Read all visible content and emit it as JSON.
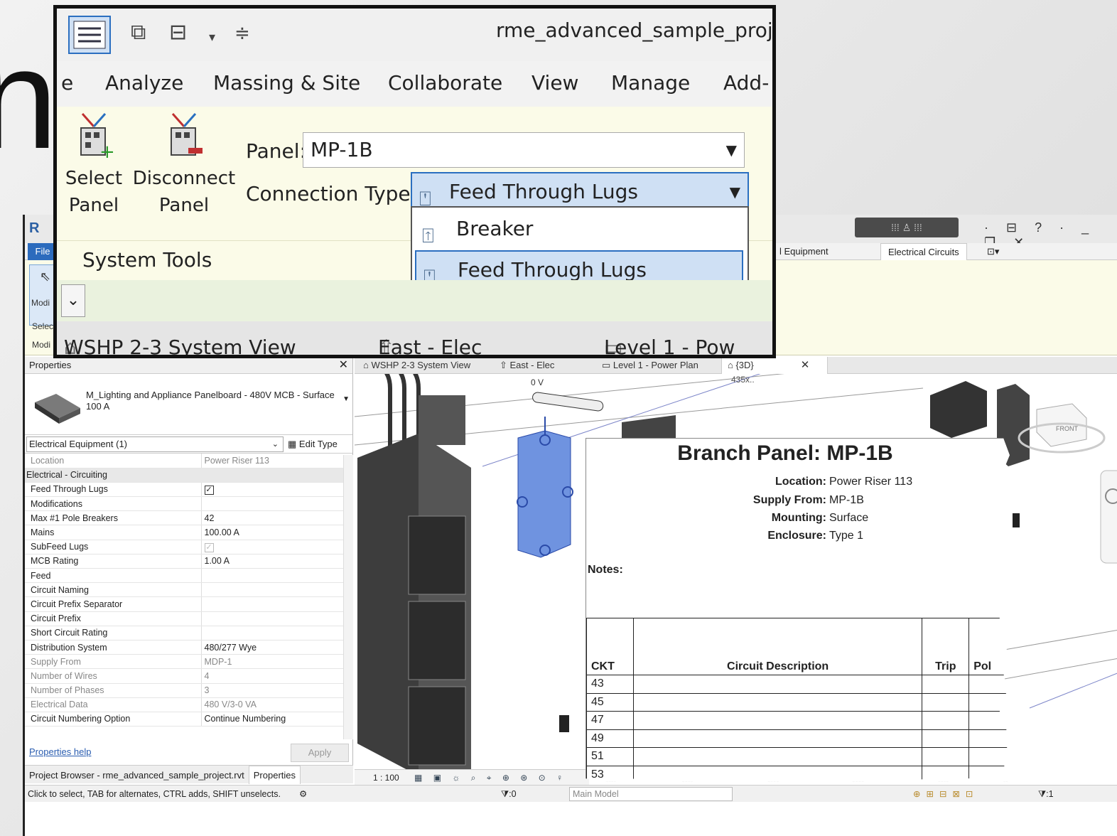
{
  "revit": {
    "file_tab": "File",
    "ribbon_tabs": [
      "l Equipment",
      "Electrical Circuits"
    ],
    "modify_button": "Modi",
    "select_label": "Selec",
    "modify_label": "Modi",
    "properties": {
      "header": "Properties",
      "type_name": "M_Lighting and Appliance Panelboard - 480V MCB - Surface\n100 A",
      "filter": "Electrical Equipment (1)",
      "edit_type": "Edit Type",
      "rows": [
        {
          "label": "Location",
          "value": "Power Riser 113",
          "dim": true
        },
        {
          "label": "Electrical - Circuiting",
          "group": true
        },
        {
          "label": "Feed Through Lugs",
          "check": "checked"
        },
        {
          "label": "Modifications",
          "value": ""
        },
        {
          "label": "Max #1 Pole Breakers",
          "value": "42"
        },
        {
          "label": "Mains",
          "value": "100.00 A"
        },
        {
          "label": "SubFeed Lugs",
          "check": "dim"
        },
        {
          "label": "MCB Rating",
          "value": "1.00 A"
        },
        {
          "label": "Feed",
          "value": ""
        },
        {
          "label": "Circuit Naming",
          "value": ""
        },
        {
          "label": "Circuit Prefix Separator",
          "value": ""
        },
        {
          "label": "Circuit Prefix",
          "value": ""
        },
        {
          "label": "Short Circuit Rating",
          "value": ""
        },
        {
          "label": "Distribution System",
          "value": "480/277 Wye"
        },
        {
          "label": "Supply From",
          "value": "MDP-1",
          "dim": true
        },
        {
          "label": "Number of Wires",
          "value": "4",
          "dim": true
        },
        {
          "label": "Number of Phases",
          "value": "3",
          "dim": true
        },
        {
          "label": "Electrical Data",
          "value": "480 V/3-0 VA",
          "dim": true
        },
        {
          "label": "Circuit Numbering Option",
          "value": "Continue Numbering"
        }
      ],
      "help_link": "Properties help",
      "apply": "Apply",
      "bottom_tabs": [
        "Project Browser - rme_advanced_sample_project.rvt",
        "Properties"
      ]
    },
    "view_tabs": [
      "WSHP 2-3 System View",
      "East - Elec",
      "Level 1 - Power Plan",
      "{3D}"
    ],
    "scale": "1 : 100",
    "status": "Click to select, TAB for alternates, CTRL adds, SHIFT unselects.",
    "status_zero": ":0",
    "main_model": "Main Model",
    "filter_count": ":1",
    "canvas_labels": {
      "voltage": "0 V",
      "tag": "435x.."
    }
  },
  "schedule": {
    "title": "Branch Panel: MP-1B",
    "fields": [
      {
        "key": "Location:",
        "value": "Power Riser 113"
      },
      {
        "key": "Supply From:",
        "value": "MP-1B"
      },
      {
        "key": "Mounting:",
        "value": "Surface"
      },
      {
        "key": "Enclosure:",
        "value": "Type 1"
      }
    ],
    "notes": "Notes:",
    "columns": [
      "CKT",
      "Circuit Description",
      "Trip",
      "Pol"
    ],
    "circuits": [
      "43",
      "45",
      "47",
      "49",
      "51",
      "53"
    ]
  },
  "zoom": {
    "project_title": "rme_advanced_sample_projec",
    "menu": [
      "e",
      "Analyze",
      "Massing & Site",
      "Collaborate",
      "View",
      "Manage",
      "Add-"
    ],
    "select_panel": "Select\nPanel",
    "disconnect_panel": "Disconnect\nPanel",
    "panel_label": "Panel:",
    "panel_value": "MP-1B",
    "connection_label": "Connection Type:",
    "connection_value": "Feed Through Lugs",
    "options": [
      "Breaker",
      "Feed Through Lugs"
    ],
    "panel_group": "System Tools",
    "view_tabs": [
      "WSHP 2-3 System View",
      "East - Elec",
      "Level 1 - Pow"
    ]
  },
  "colors": {
    "accent": "#2b6fc0",
    "selection": "#cfe0f4",
    "ribbon": "#fbfbe8",
    "element_blue": "#6f93e0"
  }
}
